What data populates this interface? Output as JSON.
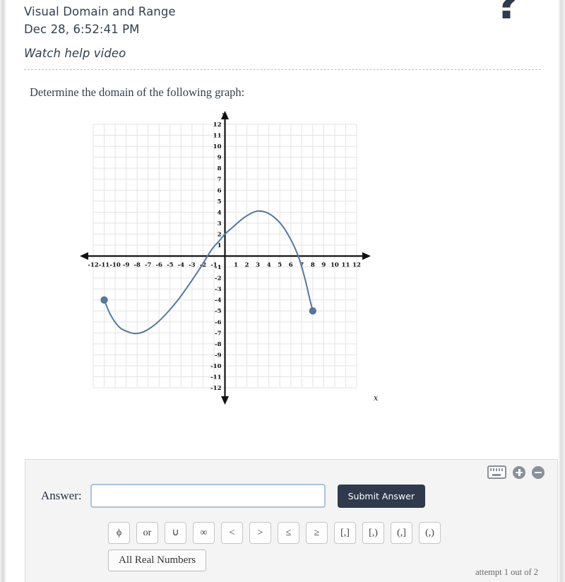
{
  "header": {
    "title": "Visual Domain and Range",
    "date": "Dec 28, 6:52:41 PM",
    "help_video": "Watch help video",
    "help_icon": "question-mark-icon"
  },
  "prompt": "Determine the domain of the following graph:",
  "chart_data": {
    "type": "line",
    "title": "",
    "xlabel": "x",
    "ylabel": "y",
    "xlim": [
      -12,
      12
    ],
    "ylim": [
      -12,
      12
    ],
    "grid": true,
    "legend": "none",
    "x_ticks": [
      -12,
      -11,
      -10,
      -9,
      -8,
      -7,
      -6,
      -5,
      -4,
      -3,
      -2,
      -1,
      1,
      2,
      3,
      4,
      5,
      6,
      7,
      8,
      9,
      10,
      11,
      12
    ],
    "y_ticks": [
      12,
      11,
      10,
      9,
      8,
      7,
      6,
      5,
      4,
      3,
      2,
      1,
      -1,
      -2,
      -3,
      -4,
      -5,
      -6,
      -7,
      -8,
      -9,
      -10,
      -11,
      -12
    ],
    "series": [
      {
        "name": "curve",
        "color": "#53789f",
        "points": [
          [
            -11,
            -4
          ],
          [
            -10.4,
            -5.4
          ],
          [
            -9.6,
            -6.5
          ],
          [
            -8.7,
            -6.95
          ],
          [
            -8,
            -7.05
          ],
          [
            -7.2,
            -6.8
          ],
          [
            -6.2,
            -6.1
          ],
          [
            -5.2,
            -5.1
          ],
          [
            -4.2,
            -3.9
          ],
          [
            -3.2,
            -2.5
          ],
          [
            -2.2,
            -1.0
          ],
          [
            -1.2,
            0.6
          ],
          [
            -0.5,
            1.4
          ],
          [
            0,
            2
          ],
          [
            0.8,
            2.7
          ],
          [
            1.6,
            3.4
          ],
          [
            2.4,
            3.9
          ],
          [
            3,
            4.1
          ],
          [
            3.7,
            4.0
          ],
          [
            4.4,
            3.6
          ],
          [
            5.2,
            2.8
          ],
          [
            6,
            1.5
          ],
          [
            6.6,
            0.2
          ],
          [
            7,
            -1.0
          ],
          [
            7.4,
            -2.5
          ],
          [
            7.7,
            -3.8
          ],
          [
            8,
            -5
          ]
        ]
      }
    ],
    "endpoints": [
      {
        "x": -11,
        "y": -4,
        "filled": true,
        "color": "#53789f"
      },
      {
        "x": 8,
        "y": -5,
        "filled": true,
        "color": "#53789f"
      }
    ]
  },
  "answer_panel": {
    "label": "Answer:",
    "input_value": "",
    "input_placeholder": "",
    "submit_label": "Submit Answer",
    "keyboard_icon": "keyboard-icon",
    "zoom_in_icon": "plus-circle-icon",
    "zoom_out_icon": "minus-circle-icon",
    "symbols": [
      "ϕ",
      "or",
      "∪",
      "∞",
      "<",
      ">",
      "≤",
      "≥",
      "[,]",
      "[,)",
      "(,]",
      "(,)"
    ],
    "all_real_numbers_label": "All Real Numbers",
    "attempt_text": "attempt 1 out of 2"
  },
  "colors": {
    "accent": "#53789f",
    "submit_bg": "#2f3b4c",
    "text": "#2f3b4c",
    "panel_bg": "#f4f4f5"
  }
}
